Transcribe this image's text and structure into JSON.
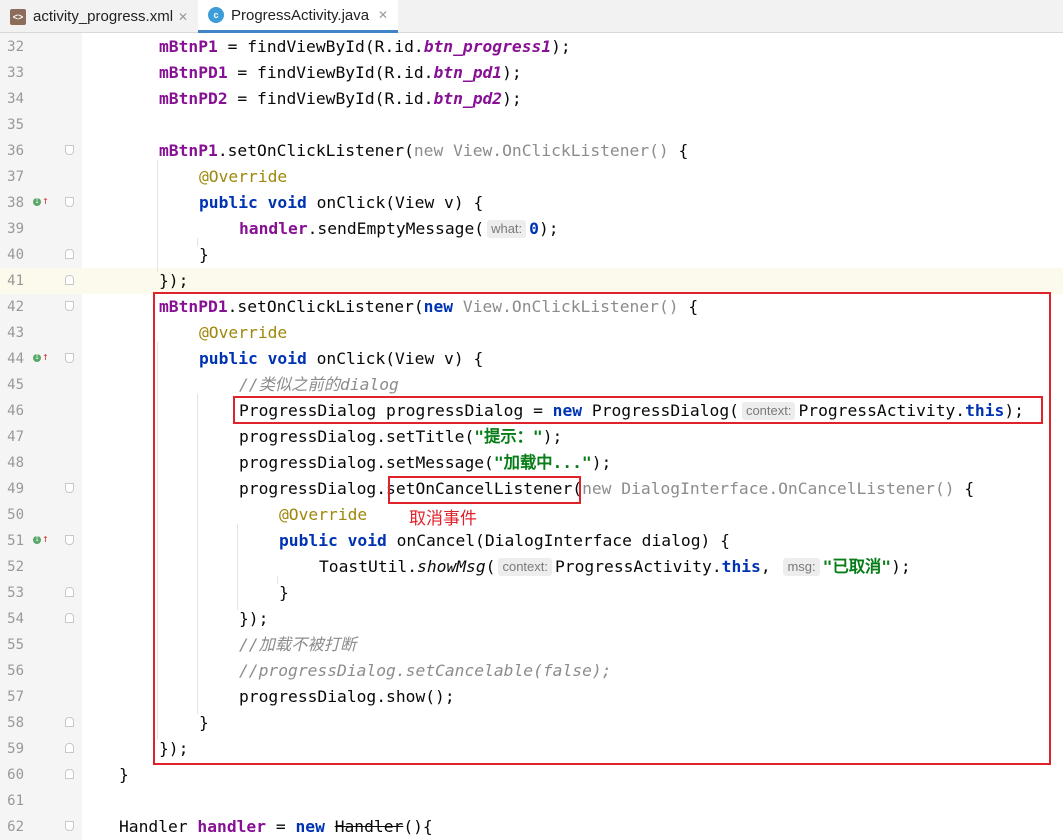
{
  "tabs": [
    {
      "label": "activity_progress.xml",
      "icon": "xml-file-icon",
      "active": false
    },
    {
      "label": "ProgressActivity.java",
      "icon": "java-class-icon",
      "active": true
    }
  ],
  "code_lines": [
    {
      "num": "32",
      "indent": 1,
      "tokens": [
        [
          "fld",
          "mBtnP1"
        ],
        [
          "p",
          " = findViewById(R.id."
        ],
        [
          "sfld",
          "btn_progress1"
        ],
        [
          "p",
          ");"
        ]
      ]
    },
    {
      "num": "33",
      "indent": 1,
      "tokens": [
        [
          "fld",
          "mBtnPD1"
        ],
        [
          "p",
          " = findViewById(R.id."
        ],
        [
          "sfld",
          "btn_pd1"
        ],
        [
          "p",
          ");"
        ]
      ]
    },
    {
      "num": "34",
      "indent": 1,
      "tokens": [
        [
          "fld",
          "mBtnPD2"
        ],
        [
          "p",
          " = findViewById(R.id."
        ],
        [
          "sfld",
          "btn_pd2"
        ],
        [
          "p",
          ");"
        ]
      ]
    },
    {
      "num": "35",
      "indent": 0,
      "tokens": []
    },
    {
      "num": "36",
      "indent": 1,
      "fold": "down",
      "tokens": [
        [
          "fld",
          "mBtnP1"
        ],
        [
          "p",
          ".setOnClickListener("
        ],
        [
          "gr",
          "new View.OnClickListener() "
        ],
        [
          "p",
          "{"
        ]
      ]
    },
    {
      "num": "37",
      "indent": 2,
      "tokens": [
        [
          "ann",
          "@Override"
        ]
      ]
    },
    {
      "num": "38",
      "indent": 2,
      "marker": true,
      "fold": "down",
      "tokens": [
        [
          "kw",
          "public void"
        ],
        [
          "p",
          " onClick(View v) {"
        ]
      ]
    },
    {
      "num": "39",
      "indent": 3,
      "tokens": [
        [
          "fld",
          "handler"
        ],
        [
          "p",
          ".sendEmptyMessage("
        ],
        [
          "hint",
          "what:"
        ],
        [
          "kw0",
          "0"
        ],
        [
          "p",
          ");"
        ]
      ]
    },
    {
      "num": "40",
      "indent": 2,
      "fold": "up",
      "tokens": [
        [
          "p",
          "}"
        ]
      ]
    },
    {
      "num": "41",
      "indent": 1,
      "fold": "up",
      "current": true,
      "tokens": [
        [
          "p",
          "});"
        ]
      ]
    },
    {
      "num": "42",
      "indent": 1,
      "fold": "down",
      "tokens": [
        [
          "fld",
          "mBtnPD1"
        ],
        [
          "p",
          ".setOnClickListener("
        ],
        [
          "kw0",
          "new"
        ],
        [
          "gr",
          " View.OnClickListener() "
        ],
        [
          "p",
          "{"
        ]
      ]
    },
    {
      "num": "43",
      "indent": 2,
      "tokens": [
        [
          "ann",
          "@Override"
        ]
      ]
    },
    {
      "num": "44",
      "indent": 2,
      "marker": true,
      "fold": "down",
      "tokens": [
        [
          "kw",
          "public void"
        ],
        [
          "p",
          " onClick(View v) {"
        ]
      ]
    },
    {
      "num": "45",
      "indent": 3,
      "tokens": [
        [
          "cmt",
          "//类似之前的dialog"
        ]
      ]
    },
    {
      "num": "46",
      "indent": 3,
      "tokens": [
        [
          "p",
          "ProgressDialog progressDialog = "
        ],
        [
          "kw",
          "new"
        ],
        [
          "p",
          " ProgressDialog("
        ],
        [
          "hint",
          "context:"
        ],
        [
          "p",
          "ProgressActivity."
        ],
        [
          "kw",
          "this"
        ],
        [
          "p",
          ");"
        ]
      ]
    },
    {
      "num": "47",
      "indent": 3,
      "tokens": [
        [
          "p",
          "progressDialog.setTitle("
        ],
        [
          "str",
          "\"提示：\""
        ],
        [
          "p",
          ");"
        ]
      ]
    },
    {
      "num": "48",
      "indent": 3,
      "tokens": [
        [
          "p",
          "progressDialog.setMessage("
        ],
        [
          "str",
          "\"加载中...\""
        ],
        [
          "p",
          ");"
        ]
      ]
    },
    {
      "num": "49",
      "indent": 3,
      "fold": "down",
      "tokens": [
        [
          "p",
          "progressDialog.setOnCancelListener("
        ],
        [
          "gr",
          "new DialogInterface.OnCancelListener() "
        ],
        [
          "p",
          "{"
        ]
      ]
    },
    {
      "num": "50",
      "indent": 4,
      "tokens": [
        [
          "ann",
          "@Override"
        ]
      ]
    },
    {
      "num": "51",
      "indent": 4,
      "marker": true,
      "fold": "down",
      "tokens": [
        [
          "kw",
          "public void"
        ],
        [
          "p",
          " onCancel(DialogInterface dialog) {"
        ]
      ]
    },
    {
      "num": "52",
      "indent": 5,
      "tokens": [
        [
          "p",
          "ToastUtil."
        ],
        [
          "smeth",
          "showMsg"
        ],
        [
          "p",
          "("
        ],
        [
          "hint",
          "context:"
        ],
        [
          "p",
          "ProgressActivity."
        ],
        [
          "kw",
          "this"
        ],
        [
          "p",
          ", "
        ],
        [
          "hint",
          "msg:"
        ],
        [
          "str",
          "\"已取消\""
        ],
        [
          "p",
          ");"
        ]
      ]
    },
    {
      "num": "53",
      "indent": 4,
      "fold": "up",
      "tokens": [
        [
          "p",
          "}"
        ]
      ]
    },
    {
      "num": "54",
      "indent": 3,
      "fold": "up",
      "tokens": [
        [
          "p",
          "});"
        ]
      ]
    },
    {
      "num": "55",
      "indent": 3,
      "tokens": [
        [
          "cmt",
          "//加载不被打断"
        ]
      ]
    },
    {
      "num": "56",
      "indent": 3,
      "tokens": [
        [
          "cmt",
          "//progressDialog.setCancelable(false);"
        ]
      ]
    },
    {
      "num": "57",
      "indent": 3,
      "tokens": [
        [
          "p",
          "progressDialog.show();"
        ]
      ]
    },
    {
      "num": "58",
      "indent": 2,
      "fold": "up",
      "tokens": [
        [
          "p",
          "}"
        ]
      ]
    },
    {
      "num": "59",
      "indent": 1,
      "fold": "up",
      "tokens": [
        [
          "p",
          "});"
        ]
      ]
    },
    {
      "num": "60",
      "indent": 0,
      "fold": "up",
      "tokens": [
        [
          "p",
          "}"
        ]
      ]
    },
    {
      "num": "61",
      "indent": 0,
      "tokens": []
    },
    {
      "num": "62",
      "indent": 0,
      "fold": "down",
      "tokens": [
        [
          "p",
          "Handler "
        ],
        [
          "fld",
          "handler"
        ],
        [
          "p",
          " = "
        ],
        [
          "kw",
          "new"
        ],
        [
          "p",
          " "
        ],
        [
          "strike",
          "Handler"
        ],
        [
          "p",
          "(){"
        ]
      ]
    }
  ],
  "annotation_note": "取消事件",
  "colors": {
    "keyword": "#0033b3",
    "field": "#871094",
    "annotation": "#9e880d",
    "comment": "#8c8c8c",
    "string": "#067d17",
    "highlight_box": "#e0222a",
    "active_tab_underline": "#4083c9"
  }
}
